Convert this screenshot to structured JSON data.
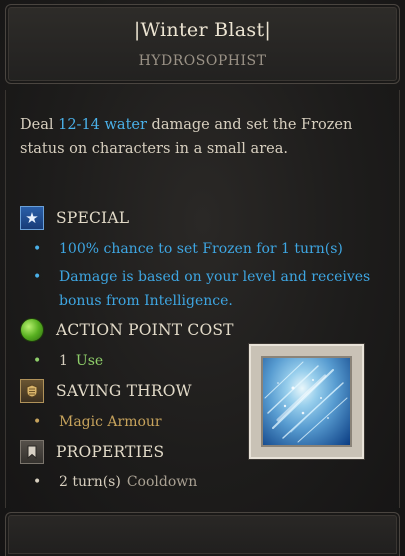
{
  "spell": {
    "title": "|Winter Blast|",
    "school": "HYDROSOPHIST",
    "description": {
      "before": "Deal ",
      "damage": "12-14 water",
      "after": " damage and set the Frozen status on characters in a small area."
    }
  },
  "sections": {
    "special": {
      "label": "SPECIAL",
      "icon": "star-icon",
      "items": [
        "100% chance to set Frozen for 1 turn(s)",
        "Damage is based on your level and receives bonus from Intelligence."
      ]
    },
    "action_point_cost": {
      "label": "ACTION POINT COST",
      "icon": "green-orb-icon",
      "value": "1",
      "unit": "Use"
    },
    "saving_throw": {
      "label": "SAVING THROW",
      "icon": "armour-icon",
      "value": "Magic Armour"
    },
    "properties": {
      "label": "PROPERTIES",
      "icon": "bookmark-icon",
      "value": "2 turn(s)",
      "unit": "Cooldown"
    }
  },
  "bullet_char": "•",
  "colors": {
    "highlight_blue": "#4ab0e8",
    "action_green": "#8fcf6a",
    "saving_gold": "#c7a35c",
    "text": "#d7cfbf"
  }
}
